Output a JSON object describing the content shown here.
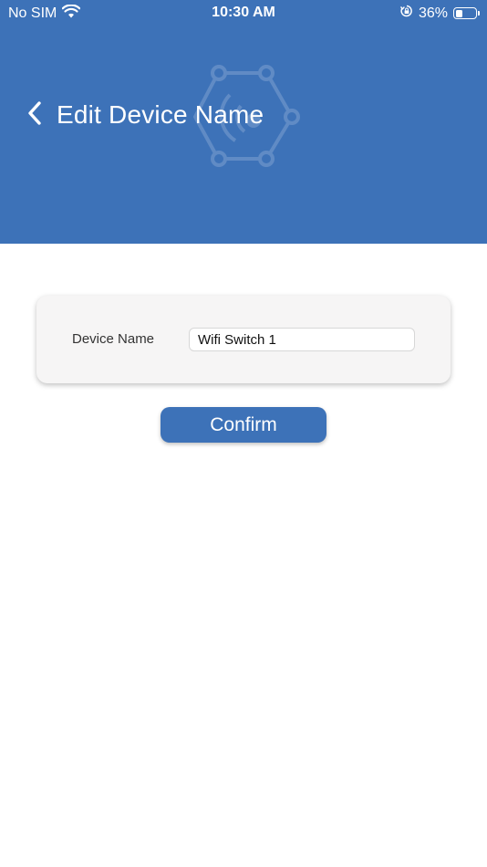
{
  "status_bar": {
    "carrier": "No SIM",
    "time": "10:30 AM",
    "battery_percent": "36%",
    "battery_level": 0.36,
    "icons": [
      "wifi-icon",
      "rotation-lock-icon",
      "battery-icon"
    ]
  },
  "header": {
    "title": "Edit Device Name",
    "back_icon": "chevron-left-icon",
    "logo_icon": "hexagon-network-icon",
    "background_color": "#3d72b8"
  },
  "form": {
    "device_name_label": "Device Name",
    "device_name_value": "Wifi Switch 1"
  },
  "actions": {
    "confirm_label": "Confirm",
    "accent_color": "#3d72b8"
  }
}
